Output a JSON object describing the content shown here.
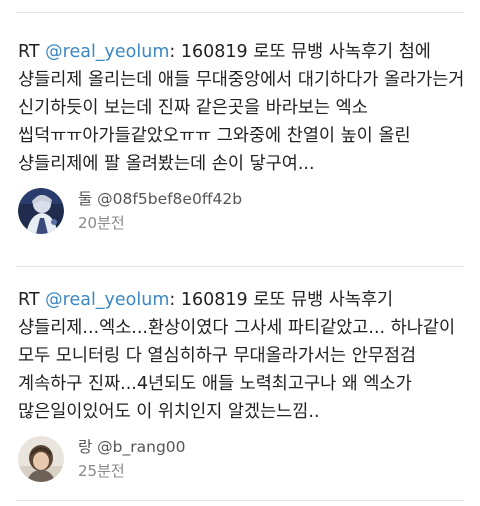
{
  "tweets": [
    {
      "rt_prefix": "RT ",
      "mention": "@real_yeolum",
      "body": ": 160819 로또 뮤뱅 사녹후기 첨에 샹들리제 올리는데 애들 무대중앙에서 대기하다가 올라가는거 신기하듯이 보는데 진짜 같은곳을 바라보는 엑소 씹덕ㅠㅠ아가들같았오ㅠㅠ 그와중에 찬열이 높이 올린 샹들리제에 팔 올려봤는데 손이 닿구여...",
      "author_name": "둘 @08f5bef8e0ff42b",
      "timestamp": "20분전"
    },
    {
      "rt_prefix": "RT ",
      "mention": "@real_yeolum",
      "body": ": 160819 로또 뮤뱅 사녹후기 샹들리제...엑소...환상이였다 그사세 파티같았고... 하나같이 모두 모니터링 다 열심히하구 무대올라가서는 안무점검 계속하구 진짜...4년되도 애들 노력최고구나 왜 엑소가 많은일이있어도 이 위치인지 알겠는느낌..",
      "author_name": "랑 @b_rang00",
      "timestamp": "25분전"
    }
  ],
  "colors": {
    "mention": "#3b88c3",
    "text": "#222222",
    "meta": "#8a8a8a",
    "divider": "#e4e4e4"
  }
}
